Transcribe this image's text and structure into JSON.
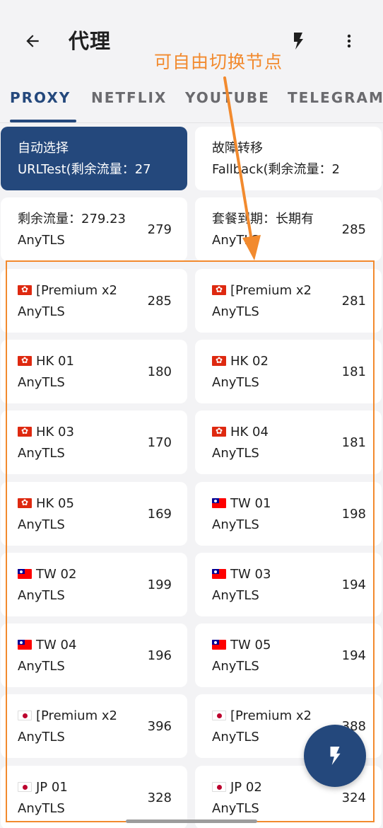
{
  "app_bar": {
    "title": "代理"
  },
  "annotation": {
    "text": "可自由切换节点",
    "color": "#f28a2e"
  },
  "tabs": [
    {
      "label": "PROXY",
      "active": true
    },
    {
      "label": "NETFLIX",
      "active": false
    },
    {
      "label": "YOUTUBE",
      "active": false
    },
    {
      "label": "TELEGRAM",
      "active": false
    }
  ],
  "colors": {
    "accent": "#24487c",
    "background": "#f3f3f5",
    "card": "#ffffff",
    "annotation": "#f28a2e"
  },
  "proxies": [
    {
      "name": "自动选择",
      "type": "URLTest(剩余流量：27",
      "delay": "",
      "flag": "",
      "selected": true
    },
    {
      "name": "故障转移",
      "type": "Fallback(剩余流量：2",
      "delay": "",
      "flag": "",
      "selected": false
    },
    {
      "name": "剩余流量：279.23",
      "type": "AnyTLS",
      "delay": "279",
      "flag": "",
      "selected": false
    },
    {
      "name": "套餐到期：长期有",
      "type": "AnyTLS",
      "delay": "285",
      "flag": "",
      "selected": false
    },
    {
      "name": "[Premium x2",
      "type": "AnyTLS",
      "delay": "285",
      "flag": "hk",
      "selected": false
    },
    {
      "name": "[Premium x2",
      "type": "AnyTLS",
      "delay": "281",
      "flag": "hk",
      "selected": false
    },
    {
      "name": "HK 01",
      "type": "AnyTLS",
      "delay": "180",
      "flag": "hk",
      "selected": false
    },
    {
      "name": "HK 02",
      "type": "AnyTLS",
      "delay": "181",
      "flag": "hk",
      "selected": false
    },
    {
      "name": "HK 03",
      "type": "AnyTLS",
      "delay": "170",
      "flag": "hk",
      "selected": false
    },
    {
      "name": "HK 04",
      "type": "AnyTLS",
      "delay": "181",
      "flag": "hk",
      "selected": false
    },
    {
      "name": "HK 05",
      "type": "AnyTLS",
      "delay": "169",
      "flag": "hk",
      "selected": false
    },
    {
      "name": "TW 01",
      "type": "AnyTLS",
      "delay": "198",
      "flag": "tw",
      "selected": false
    },
    {
      "name": "TW 02",
      "type": "AnyTLS",
      "delay": "199",
      "flag": "tw",
      "selected": false
    },
    {
      "name": "TW 03",
      "type": "AnyTLS",
      "delay": "194",
      "flag": "tw",
      "selected": false
    },
    {
      "name": "TW 04",
      "type": "AnyTLS",
      "delay": "196",
      "flag": "tw",
      "selected": false
    },
    {
      "name": "TW 05",
      "type": "AnyTLS",
      "delay": "194",
      "flag": "tw",
      "selected": false
    },
    {
      "name": "[Premium x2",
      "type": "AnyTLS",
      "delay": "396",
      "flag": "jp",
      "selected": false
    },
    {
      "name": "[Premium x2",
      "type": "AnyTLS",
      "delay": "388",
      "flag": "jp",
      "selected": false
    },
    {
      "name": "JP 01",
      "type": "AnyTLS",
      "delay": "328",
      "flag": "jp",
      "selected": false
    },
    {
      "name": "JP 02",
      "type": "AnyTLS",
      "delay": "324",
      "flag": "jp",
      "selected": false
    }
  ],
  "icons": {
    "back": "arrow-back-icon",
    "test": "flash-icon",
    "more": "more-vert-icon",
    "fab": "flash-icon"
  }
}
